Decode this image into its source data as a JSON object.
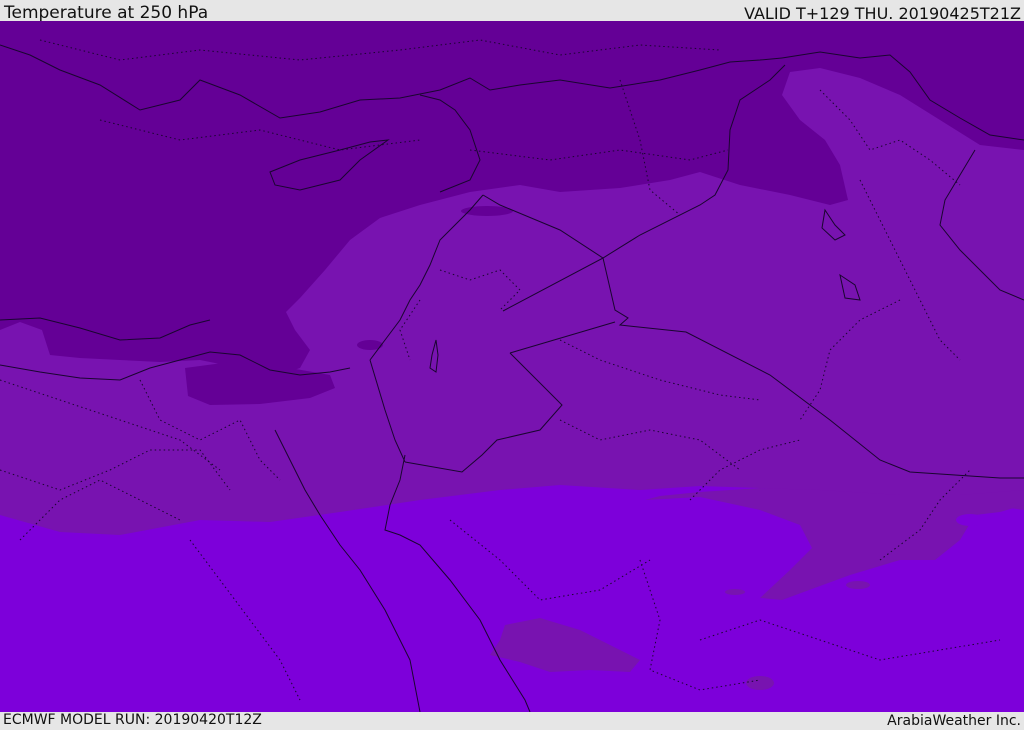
{
  "header": {
    "title": "Temperature at 250 hPa",
    "valid": "VALID T+129 THU. 20190425T21Z"
  },
  "footer": {
    "model_run": "ECMWF MODEL RUN: 20190420T12Z",
    "credit": "ArabiaWeather Inc."
  },
  "map": {
    "variable": "Temperature",
    "level": "250 hPa",
    "colors": {
      "coldest": "#640096",
      "cold": "#7813b0",
      "mild": "#7d00da",
      "borders": "#1a0530"
    }
  }
}
